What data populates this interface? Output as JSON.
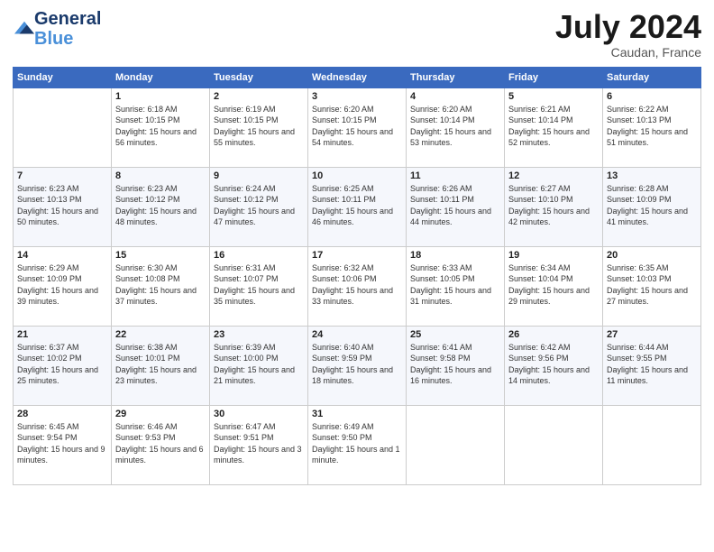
{
  "logo": {
    "line1": "General",
    "line2": "Blue"
  },
  "title": "July 2024",
  "location": "Caudan, France",
  "days_header": [
    "Sunday",
    "Monday",
    "Tuesday",
    "Wednesday",
    "Thursday",
    "Friday",
    "Saturday"
  ],
  "weeks": [
    [
      {
        "day": "",
        "sunrise": "",
        "sunset": "",
        "daylight": ""
      },
      {
        "day": "1",
        "sunrise": "Sunrise: 6:18 AM",
        "sunset": "Sunset: 10:15 PM",
        "daylight": "Daylight: 15 hours and 56 minutes."
      },
      {
        "day": "2",
        "sunrise": "Sunrise: 6:19 AM",
        "sunset": "Sunset: 10:15 PM",
        "daylight": "Daylight: 15 hours and 55 minutes."
      },
      {
        "day": "3",
        "sunrise": "Sunrise: 6:20 AM",
        "sunset": "Sunset: 10:15 PM",
        "daylight": "Daylight: 15 hours and 54 minutes."
      },
      {
        "day": "4",
        "sunrise": "Sunrise: 6:20 AM",
        "sunset": "Sunset: 10:14 PM",
        "daylight": "Daylight: 15 hours and 53 minutes."
      },
      {
        "day": "5",
        "sunrise": "Sunrise: 6:21 AM",
        "sunset": "Sunset: 10:14 PM",
        "daylight": "Daylight: 15 hours and 52 minutes."
      },
      {
        "day": "6",
        "sunrise": "Sunrise: 6:22 AM",
        "sunset": "Sunset: 10:13 PM",
        "daylight": "Daylight: 15 hours and 51 minutes."
      }
    ],
    [
      {
        "day": "7",
        "sunrise": "Sunrise: 6:23 AM",
        "sunset": "Sunset: 10:13 PM",
        "daylight": "Daylight: 15 hours and 50 minutes."
      },
      {
        "day": "8",
        "sunrise": "Sunrise: 6:23 AM",
        "sunset": "Sunset: 10:12 PM",
        "daylight": "Daylight: 15 hours and 48 minutes."
      },
      {
        "day": "9",
        "sunrise": "Sunrise: 6:24 AM",
        "sunset": "Sunset: 10:12 PM",
        "daylight": "Daylight: 15 hours and 47 minutes."
      },
      {
        "day": "10",
        "sunrise": "Sunrise: 6:25 AM",
        "sunset": "Sunset: 10:11 PM",
        "daylight": "Daylight: 15 hours and 46 minutes."
      },
      {
        "day": "11",
        "sunrise": "Sunrise: 6:26 AM",
        "sunset": "Sunset: 10:11 PM",
        "daylight": "Daylight: 15 hours and 44 minutes."
      },
      {
        "day": "12",
        "sunrise": "Sunrise: 6:27 AM",
        "sunset": "Sunset: 10:10 PM",
        "daylight": "Daylight: 15 hours and 42 minutes."
      },
      {
        "day": "13",
        "sunrise": "Sunrise: 6:28 AM",
        "sunset": "Sunset: 10:09 PM",
        "daylight": "Daylight: 15 hours and 41 minutes."
      }
    ],
    [
      {
        "day": "14",
        "sunrise": "Sunrise: 6:29 AM",
        "sunset": "Sunset: 10:09 PM",
        "daylight": "Daylight: 15 hours and 39 minutes."
      },
      {
        "day": "15",
        "sunrise": "Sunrise: 6:30 AM",
        "sunset": "Sunset: 10:08 PM",
        "daylight": "Daylight: 15 hours and 37 minutes."
      },
      {
        "day": "16",
        "sunrise": "Sunrise: 6:31 AM",
        "sunset": "Sunset: 10:07 PM",
        "daylight": "Daylight: 15 hours and 35 minutes."
      },
      {
        "day": "17",
        "sunrise": "Sunrise: 6:32 AM",
        "sunset": "Sunset: 10:06 PM",
        "daylight": "Daylight: 15 hours and 33 minutes."
      },
      {
        "day": "18",
        "sunrise": "Sunrise: 6:33 AM",
        "sunset": "Sunset: 10:05 PM",
        "daylight": "Daylight: 15 hours and 31 minutes."
      },
      {
        "day": "19",
        "sunrise": "Sunrise: 6:34 AM",
        "sunset": "Sunset: 10:04 PM",
        "daylight": "Daylight: 15 hours and 29 minutes."
      },
      {
        "day": "20",
        "sunrise": "Sunrise: 6:35 AM",
        "sunset": "Sunset: 10:03 PM",
        "daylight": "Daylight: 15 hours and 27 minutes."
      }
    ],
    [
      {
        "day": "21",
        "sunrise": "Sunrise: 6:37 AM",
        "sunset": "Sunset: 10:02 PM",
        "daylight": "Daylight: 15 hours and 25 minutes."
      },
      {
        "day": "22",
        "sunrise": "Sunrise: 6:38 AM",
        "sunset": "Sunset: 10:01 PM",
        "daylight": "Daylight: 15 hours and 23 minutes."
      },
      {
        "day": "23",
        "sunrise": "Sunrise: 6:39 AM",
        "sunset": "Sunset: 10:00 PM",
        "daylight": "Daylight: 15 hours and 21 minutes."
      },
      {
        "day": "24",
        "sunrise": "Sunrise: 6:40 AM",
        "sunset": "Sunset: 9:59 PM",
        "daylight": "Daylight: 15 hours and 18 minutes."
      },
      {
        "day": "25",
        "sunrise": "Sunrise: 6:41 AM",
        "sunset": "Sunset: 9:58 PM",
        "daylight": "Daylight: 15 hours and 16 minutes."
      },
      {
        "day": "26",
        "sunrise": "Sunrise: 6:42 AM",
        "sunset": "Sunset: 9:56 PM",
        "daylight": "Daylight: 15 hours and 14 minutes."
      },
      {
        "day": "27",
        "sunrise": "Sunrise: 6:44 AM",
        "sunset": "Sunset: 9:55 PM",
        "daylight": "Daylight: 15 hours and 11 minutes."
      }
    ],
    [
      {
        "day": "28",
        "sunrise": "Sunrise: 6:45 AM",
        "sunset": "Sunset: 9:54 PM",
        "daylight": "Daylight: 15 hours and 9 minutes."
      },
      {
        "day": "29",
        "sunrise": "Sunrise: 6:46 AM",
        "sunset": "Sunset: 9:53 PM",
        "daylight": "Daylight: 15 hours and 6 minutes."
      },
      {
        "day": "30",
        "sunrise": "Sunrise: 6:47 AM",
        "sunset": "Sunset: 9:51 PM",
        "daylight": "Daylight: 15 hours and 3 minutes."
      },
      {
        "day": "31",
        "sunrise": "Sunrise: 6:49 AM",
        "sunset": "Sunset: 9:50 PM",
        "daylight": "Daylight: 15 hours and 1 minute."
      },
      {
        "day": "",
        "sunrise": "",
        "sunset": "",
        "daylight": ""
      },
      {
        "day": "",
        "sunrise": "",
        "sunset": "",
        "daylight": ""
      },
      {
        "day": "",
        "sunrise": "",
        "sunset": "",
        "daylight": ""
      }
    ]
  ]
}
